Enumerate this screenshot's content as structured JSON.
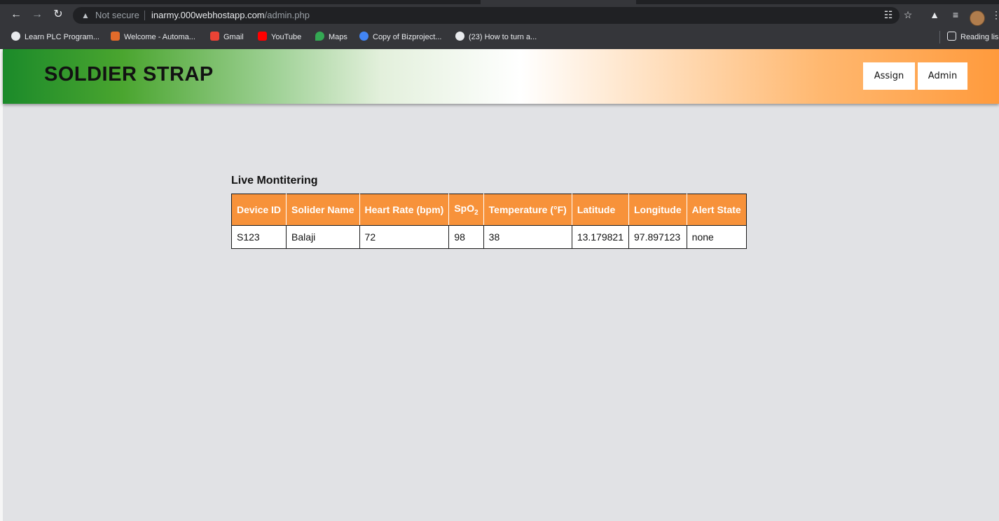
{
  "browser": {
    "not_secure": "Not secure",
    "url_host": "inarmy.000webhostapp.com",
    "url_path": "/admin.php",
    "bookmarks": [
      {
        "label": "Learn PLC Program...",
        "color": "#e8eaed"
      },
      {
        "label": "Welcome - Automa...",
        "color": "#e26b2a"
      },
      {
        "label": "Gmail",
        "color": "#ea4335"
      },
      {
        "label": "YouTube",
        "color": "#ff0000"
      },
      {
        "label": "Maps",
        "color": "#34a853"
      },
      {
        "label": "Copy of Bizproject...",
        "color": "#4285f4"
      },
      {
        "label": "(23) How to turn a...",
        "color": "#e8eaed"
      }
    ],
    "reading_list": "Reading lis"
  },
  "header": {
    "brand": "SOLDIER STRAP",
    "assign_label": "Assign",
    "admin_label": "Admin"
  },
  "main": {
    "section_title": "Live Montitering",
    "table": {
      "columns": [
        "Device ID",
        "Solider Name",
        "Heart Rate (bpm)",
        "SpO",
        "Temperature (°F)",
        "Latitude",
        "Longitude",
        "Alert State"
      ],
      "spo2_subscript": "2",
      "rows": [
        [
          "S123",
          "Balaji",
          "72",
          "98",
          "38",
          "13.179821",
          "97.897123",
          "none"
        ]
      ]
    }
  },
  "colors": {
    "accent_orange": "#f7923a",
    "flag_green": "#1b8a2a",
    "page_bg": "#e1e2e5"
  }
}
